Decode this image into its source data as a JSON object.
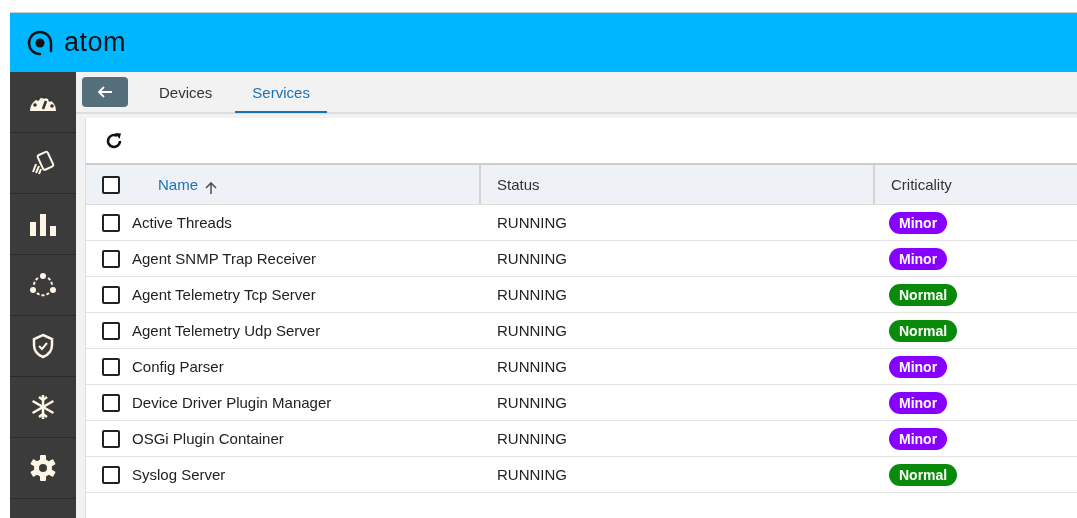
{
  "header": {
    "logo_text": "atom"
  },
  "sidebar": {
    "items": [
      {
        "kind": "dashboard",
        "selected": false
      },
      {
        "kind": "cards",
        "selected": false
      },
      {
        "kind": "chart",
        "selected": false
      },
      {
        "kind": "network",
        "selected": false
      },
      {
        "kind": "shield",
        "selected": false
      },
      {
        "kind": "snowflake",
        "selected": false
      },
      {
        "kind": "gear",
        "selected": false
      }
    ]
  },
  "tabs": [
    {
      "label": "Devices",
      "selected": false
    },
    {
      "label": "Services",
      "selected": true
    }
  ],
  "table": {
    "columns": [
      {
        "label": "Name",
        "sorted": true
      },
      {
        "label": "Status"
      },
      {
        "label": "Criticality"
      }
    ],
    "header_checked": false,
    "rows": [
      {
        "name": "Active Threads",
        "status": "RUNNING",
        "criticality": "Minor",
        "color": "#8800ff",
        "checked": false
      },
      {
        "name": "Agent SNMP Trap Receiver",
        "status": "RUNNING",
        "criticality": "Minor",
        "color": "#8800ff",
        "checked": false
      },
      {
        "name": "Agent Telemetry Tcp Server",
        "status": "RUNNING",
        "criticality": "Normal",
        "color": "#0a8a0a",
        "checked": false
      },
      {
        "name": "Agent Telemetry Udp Server",
        "status": "RUNNING",
        "criticality": "Normal",
        "color": "#0a8a0a",
        "checked": false
      },
      {
        "name": "Config Parser",
        "status": "RUNNING",
        "criticality": "Minor",
        "color": "#8800ff",
        "checked": false
      },
      {
        "name": "Device Driver Plugin Manager",
        "status": "RUNNING",
        "criticality": "Minor",
        "color": "#8800ff",
        "checked": false
      },
      {
        "name": "OSGi Plugin Container",
        "status": "RUNNING",
        "criticality": "Minor",
        "color": "#8800ff",
        "checked": false
      },
      {
        "name": "Syslog Server",
        "status": "RUNNING",
        "criticality": "Normal",
        "color": "#0a8a0a",
        "checked": false
      }
    ]
  }
}
